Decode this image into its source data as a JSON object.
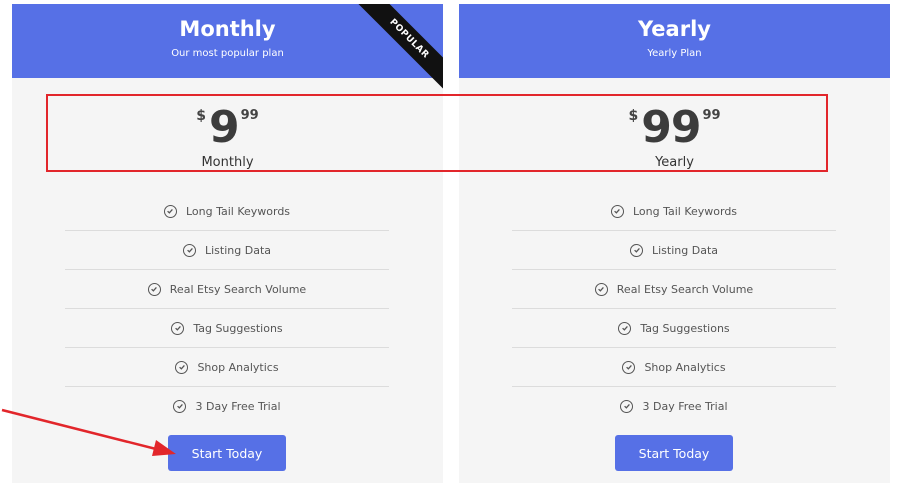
{
  "plans": [
    {
      "title": "Monthly",
      "subtitle": "Our most popular plan",
      "badge": "POPULAR",
      "currency": "$",
      "amount": "9",
      "cents": "99",
      "period": "Monthly",
      "features": [
        "Long Tail Keywords",
        "Listing Data",
        "Real Etsy Search Volume",
        "Tag Suggestions",
        "Shop Analytics",
        "3 Day Free Trial"
      ],
      "cta": "Start Today"
    },
    {
      "title": "Yearly",
      "subtitle": "Yearly Plan",
      "currency": "$",
      "amount": "99",
      "cents": "99",
      "period": "Yearly",
      "features": [
        "Long Tail Keywords",
        "Listing Data",
        "Real Etsy Search Volume",
        "Tag Suggestions",
        "Shop Analytics",
        "3 Day Free Trial"
      ],
      "cta": "Start Today"
    }
  ],
  "colors": {
    "header": "#5670e6",
    "button": "#5670e6",
    "card_background": "#f5f5f5",
    "annotation": "#e2262b",
    "ribbon": "#111111"
  },
  "icons": {
    "feature": "check-circle-icon"
  }
}
